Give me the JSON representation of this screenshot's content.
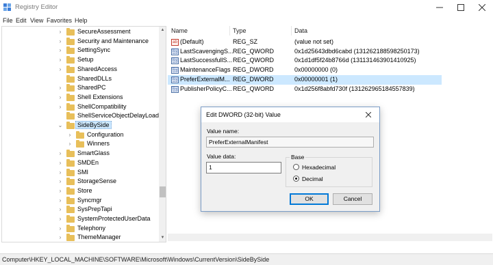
{
  "window": {
    "title": "Registry Editor"
  },
  "menu": [
    "File",
    "Edit",
    "View",
    "Favorites",
    "Help"
  ],
  "tree": {
    "items": [
      {
        "label": "SecureAssessment",
        "level": 0,
        "expander": "collapsed"
      },
      {
        "label": "Security and Maintenance",
        "level": 0,
        "expander": "collapsed"
      },
      {
        "label": "SettingSync",
        "level": 0,
        "expander": "collapsed"
      },
      {
        "label": "Setup",
        "level": 0,
        "expander": "collapsed"
      },
      {
        "label": "SharedAccess",
        "level": 0,
        "expander": "collapsed"
      },
      {
        "label": "SharedDLLs",
        "level": 0,
        "expander": "none"
      },
      {
        "label": "SharedPC",
        "level": 0,
        "expander": "collapsed"
      },
      {
        "label": "Shell Extensions",
        "level": 0,
        "expander": "collapsed"
      },
      {
        "label": "ShellCompatibility",
        "level": 0,
        "expander": "collapsed"
      },
      {
        "label": "ShellServiceObjectDelayLoad",
        "level": 0,
        "expander": "none"
      },
      {
        "label": "SideBySide",
        "level": 0,
        "expander": "expanded",
        "selected": true
      },
      {
        "label": "Configuration",
        "level": 1,
        "expander": "collapsed"
      },
      {
        "label": "Winners",
        "level": 1,
        "expander": "collapsed"
      },
      {
        "label": "SmartGlass",
        "level": 0,
        "expander": "collapsed"
      },
      {
        "label": "SMDEn",
        "level": 0,
        "expander": "collapsed"
      },
      {
        "label": "SMI",
        "level": 0,
        "expander": "collapsed"
      },
      {
        "label": "StorageSense",
        "level": 0,
        "expander": "collapsed"
      },
      {
        "label": "Store",
        "level": 0,
        "expander": "collapsed"
      },
      {
        "label": "Syncmgr",
        "level": 0,
        "expander": "collapsed"
      },
      {
        "label": "SysPrepTapi",
        "level": 0,
        "expander": "collapsed"
      },
      {
        "label": "SystemProtectedUserData",
        "level": 0,
        "expander": "collapsed"
      },
      {
        "label": "Telephony",
        "level": 0,
        "expander": "collapsed"
      },
      {
        "label": "ThemeManager",
        "level": 0,
        "expander": "collapsed"
      }
    ]
  },
  "list": {
    "headers": {
      "name": "Name",
      "type": "Type",
      "data": "Data"
    },
    "rows": [
      {
        "icon": "string-value-icon",
        "name": "(Default)",
        "type": "REG_SZ",
        "data": "(value not set)"
      },
      {
        "icon": "binary-value-icon",
        "name": "LastScavengingS...",
        "type": "REG_QWORD",
        "data": "0x1d25643dbd6cabd (131262188598250173)"
      },
      {
        "icon": "binary-value-icon",
        "name": "LastSuccessfullS...",
        "type": "REG_QWORD",
        "data": "0x1d1df5f24b8766d (131131463901410925)"
      },
      {
        "icon": "binary-value-icon",
        "name": "MaintenanceFlags",
        "type": "REG_DWORD",
        "data": "0x00000000 (0)"
      },
      {
        "icon": "binary-value-icon",
        "name": "PreferExternalM...",
        "type": "REG_DWORD",
        "data": "0x00000001 (1)",
        "selected": true
      },
      {
        "icon": "binary-value-icon",
        "name": "PublisherPolicyC...",
        "type": "REG_QWORD",
        "data": "0x1d256f8abfd730f (131262965184557839)"
      }
    ]
  },
  "status": {
    "path": "Computer\\HKEY_LOCAL_MACHINE\\SOFTWARE\\Microsoft\\Windows\\CurrentVersion\\SideBySide"
  },
  "dialog": {
    "title": "Edit DWORD (32-bit) Value",
    "value_name_label": "Value name:",
    "value_name": "PreferExternalManifest",
    "value_data_label": "Value data:",
    "value_data": "1",
    "base_label": "Base",
    "hex_label": "Hexadecimal",
    "dec_label": "Decimal",
    "selected_base": "Decimal",
    "ok_label": "OK",
    "cancel_label": "Cancel"
  },
  "colors": {
    "folder": "#e8bf5a",
    "selection": "#cce8ff",
    "accent": "#0078d7"
  }
}
